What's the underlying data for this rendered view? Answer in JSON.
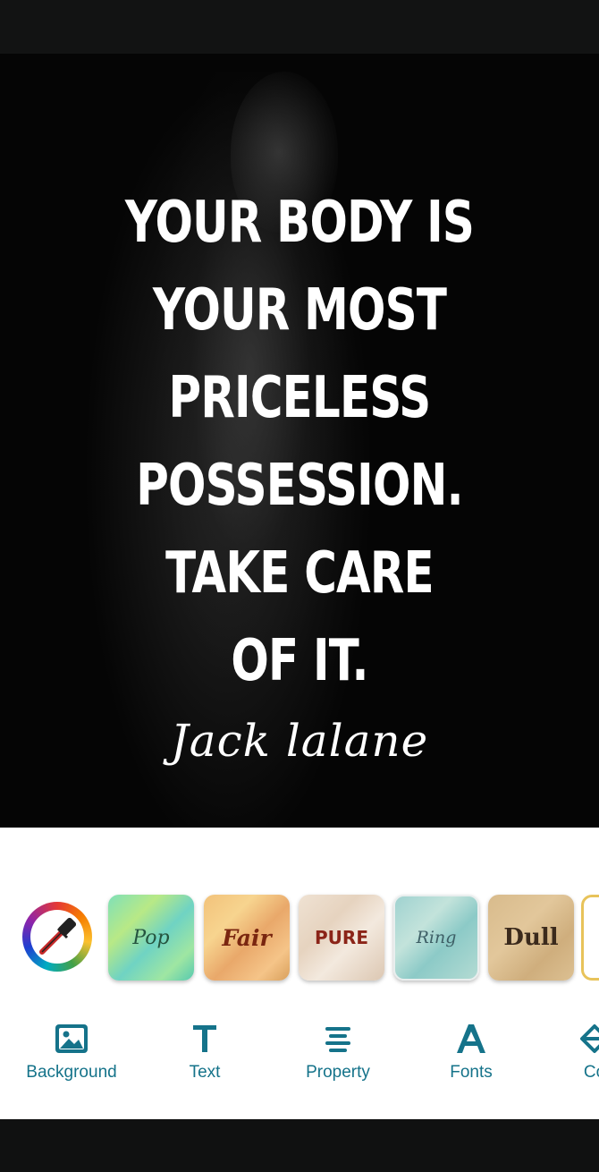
{
  "canvas": {
    "quote_lines": [
      "YOUR BODY IS",
      "YOUR MOST",
      "PRICELESS",
      "POSSESSION.",
      "TAKE CARE",
      "OF IT."
    ],
    "author": "Jack lalane"
  },
  "panel": {
    "color_picker_icon": "eyedropper-color-wheel-icon",
    "background_tiles": [
      {
        "label": "Pop"
      },
      {
        "label": "Fair"
      },
      {
        "label": "PURE"
      },
      {
        "label": "Ring"
      },
      {
        "label": "Dull"
      }
    ],
    "tabs": [
      {
        "label": "Background",
        "icon": "image-icon"
      },
      {
        "label": "Text",
        "icon": "text-icon"
      },
      {
        "label": "Property",
        "icon": "align-center-icon"
      },
      {
        "label": "Fonts",
        "icon": "font-icon"
      },
      {
        "label": "Co",
        "icon": "paint-bucket-icon"
      }
    ],
    "accent_color": "#15738a"
  }
}
